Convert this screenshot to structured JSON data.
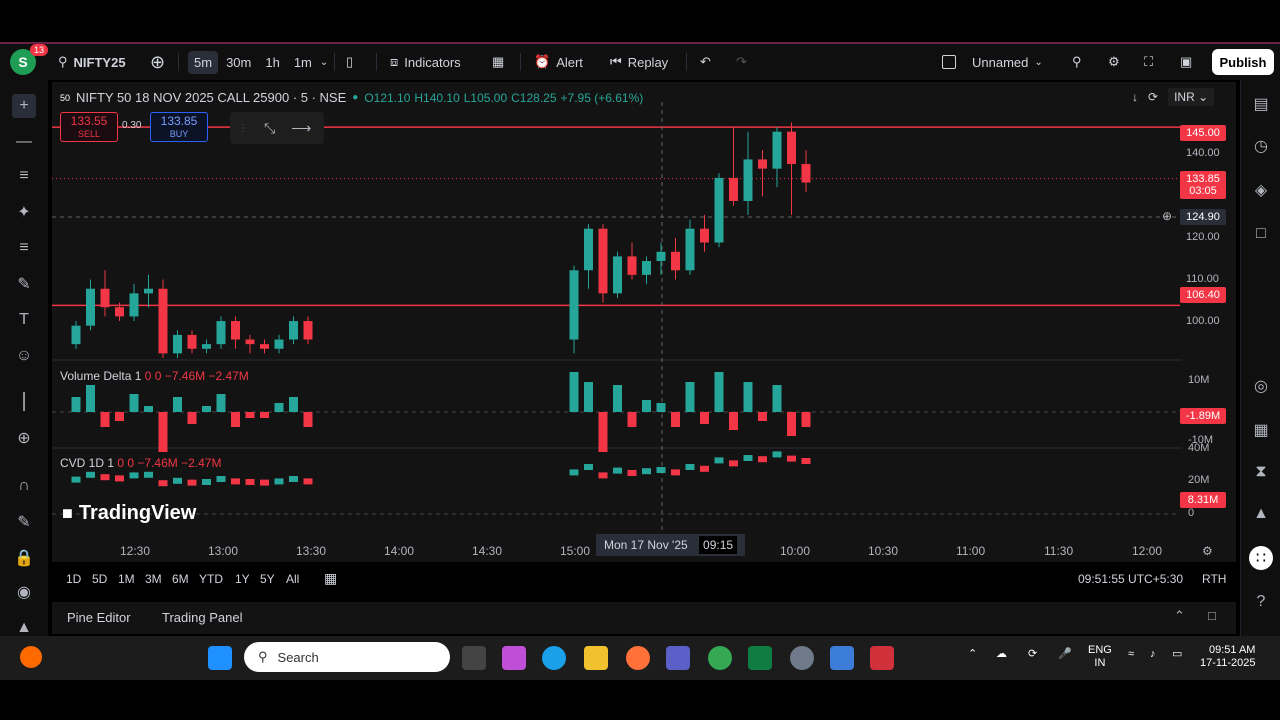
{
  "toolbar": {
    "avatar_letter": "S",
    "notif_count": "13",
    "symbol": "NIFTY25",
    "intervals": [
      "5m",
      "30m",
      "1h",
      "1m"
    ],
    "indicators": "Indicators",
    "alert": "Alert",
    "replay": "Replay",
    "layout_name": "Unnamed",
    "publish": "Publish"
  },
  "legend": {
    "title": "NIFTY 50 18 NOV 2025 CALL 25900 · 5 · NSE",
    "o": "O121.10",
    "h": "H140.10",
    "l": "L105.00",
    "c": "C128.25",
    "chg": "+7.95 (+6.61%)"
  },
  "trade": {
    "sell_price": "133.55",
    "sell_label": "SELL",
    "spread": "0.30",
    "buy_price": "133.85",
    "buy_label": "BUY"
  },
  "currency": "INR",
  "price_labels": [
    "140.00",
    "120.00",
    "110.00",
    "100.00"
  ],
  "price_tags": {
    "level1": "145.00",
    "current": "133.85",
    "countdown": "03:05",
    "crosshair": "124.90",
    "level2": "106.40",
    "vol_delta": "-1.89M",
    "cvd": "8.31M"
  },
  "volume_labels": {
    "top": "10M",
    "mid": "0",
    "bottom": "-10M"
  },
  "cvd_labels": {
    "top": "40M",
    "mid": "20M",
    "bottom": "0"
  },
  "panels": {
    "vol_title": "Volume Delta 1",
    "vol_values": "0  0  −7.46M  −2.47M",
    "cvd_title": "CVD 1D 1",
    "cvd_values": "0  0  −7.46M  −2.47M"
  },
  "brand": "TradingView",
  "time_labels": [
    "12:30",
    "13:00",
    "13:30",
    "14:00",
    "14:30",
    "15:00",
    "10:00",
    "10:30",
    "11:00",
    "11:30",
    "12:00"
  ],
  "crosshair_time": "Mon 17 Nov '25",
  "crosshair_time2": "09:15",
  "ranges": [
    "1D",
    "5D",
    "1M",
    "3M",
    "6M",
    "YTD",
    "1Y",
    "5Y",
    "All"
  ],
  "clock": "09:51:55 UTC+5:30",
  "session": "RTH",
  "bottom_tabs": [
    "Pine Editor",
    "Trading Panel"
  ],
  "taskbar": {
    "search": "Search",
    "lang1": "ENG",
    "lang2": "IN",
    "time": "09:51 AM",
    "date": "17-11-2025"
  },
  "chart_data": {
    "type": "candlestick",
    "title": "NIFTY 50 18 NOV 2025 CALL 25900 · 5 · NSE",
    "ylim": [
      95,
      150
    ],
    "levels": [
      145.0,
      106.4
    ],
    "current_price": 133.85,
    "candles": [
      [
        98,
        103,
        97,
        102
      ],
      [
        102,
        112,
        101,
        110
      ],
      [
        110,
        114,
        104,
        106
      ],
      [
        106,
        107,
        103,
        104
      ],
      [
        104,
        111,
        103,
        109
      ],
      [
        109,
        113,
        106,
        110
      ],
      [
        110,
        112,
        95,
        96
      ],
      [
        96,
        101,
        95,
        100
      ],
      [
        100,
        101,
        96,
        97
      ],
      [
        97,
        99,
        96,
        98
      ],
      [
        98,
        104,
        97,
        103
      ],
      [
        103,
        104,
        97,
        99
      ],
      [
        99,
        100,
        96,
        98
      ],
      [
        98,
        99,
        96,
        97
      ],
      [
        97,
        100,
        96,
        99
      ],
      [
        99,
        104,
        98,
        103
      ],
      [
        103,
        104,
        98,
        99
      ],
      [
        99,
        115,
        96,
        114
      ],
      [
        114,
        124,
        110,
        123
      ],
      [
        123,
        124,
        107,
        109
      ],
      [
        109,
        118,
        108,
        117
      ],
      [
        117,
        120,
        112,
        113
      ],
      [
        113,
        117,
        111,
        116
      ],
      [
        116,
        120,
        113,
        118
      ],
      [
        118,
        121,
        112,
        114
      ],
      [
        114,
        125,
        113,
        123
      ],
      [
        123,
        126,
        118,
        120
      ],
      [
        120,
        135,
        119,
        134
      ],
      [
        134,
        145,
        128,
        129
      ],
      [
        129,
        144,
        126,
        138
      ],
      [
        138,
        140,
        130,
        136
      ],
      [
        136,
        145,
        132,
        144
      ],
      [
        144,
        146,
        126,
        137
      ],
      [
        137,
        140,
        131,
        133
      ]
    ]
  }
}
